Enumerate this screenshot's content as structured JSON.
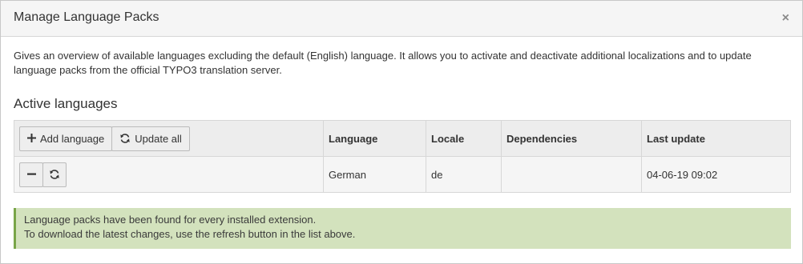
{
  "modal": {
    "title": "Manage Language Packs",
    "close_glyph": "×"
  },
  "description": "Gives an overview of available languages excluding the default (English) language. It allows you to activate and deactivate additional localizations and to update language packs from the official TYPO3 translation server.",
  "section_title": "Active languages",
  "toolbar": {
    "add_language_label": "Add language",
    "update_all_label": "Update all",
    "add_icon": "plus-icon",
    "update_icon": "refresh-icon"
  },
  "table": {
    "headers": {
      "language": "Language",
      "locale": "Locale",
      "dependencies": "Dependencies",
      "last_update": "Last update"
    },
    "rows": [
      {
        "language": "German",
        "locale": "de",
        "dependencies": "",
        "last_update": "04-06-19 09:02",
        "remove_icon": "minus-icon",
        "update_icon": "refresh-icon"
      }
    ]
  },
  "alert": {
    "line1": "Language packs have been found for every installed extension.",
    "line2": "To download the latest changes, use the refresh button in the list above.",
    "color": "#d3e2bd",
    "border_color": "#79a548"
  }
}
